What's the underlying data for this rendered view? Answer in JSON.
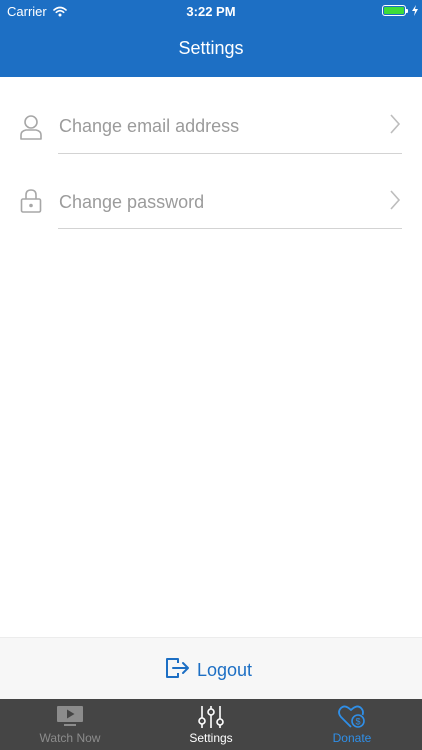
{
  "status_bar": {
    "carrier": "Carrier",
    "time": "3:22 PM"
  },
  "nav": {
    "title": "Settings"
  },
  "settings_items": [
    {
      "label": "Change email address",
      "icon": "person-icon"
    },
    {
      "label": "Change password",
      "icon": "lock-icon"
    }
  ],
  "logout": {
    "label": "Logout",
    "icon": "logout-icon"
  },
  "tabbar": {
    "tabs": [
      {
        "label": "Watch Now",
        "icon": "play-screen-icon",
        "state": "inactive"
      },
      {
        "label": "Settings",
        "icon": "sliders-icon",
        "state": "selected"
      },
      {
        "label": "Donate",
        "icon": "heart-dollar-icon",
        "state": "accent"
      }
    ]
  },
  "colors": {
    "brand_blue": "#1d6fc4",
    "tab_inactive": "#8c8c8c",
    "tab_selected": "#ffffff",
    "tab_accent": "#2f8fe8",
    "tabbar_bg": "#454545",
    "battery_fill": "#3ddc3a"
  }
}
